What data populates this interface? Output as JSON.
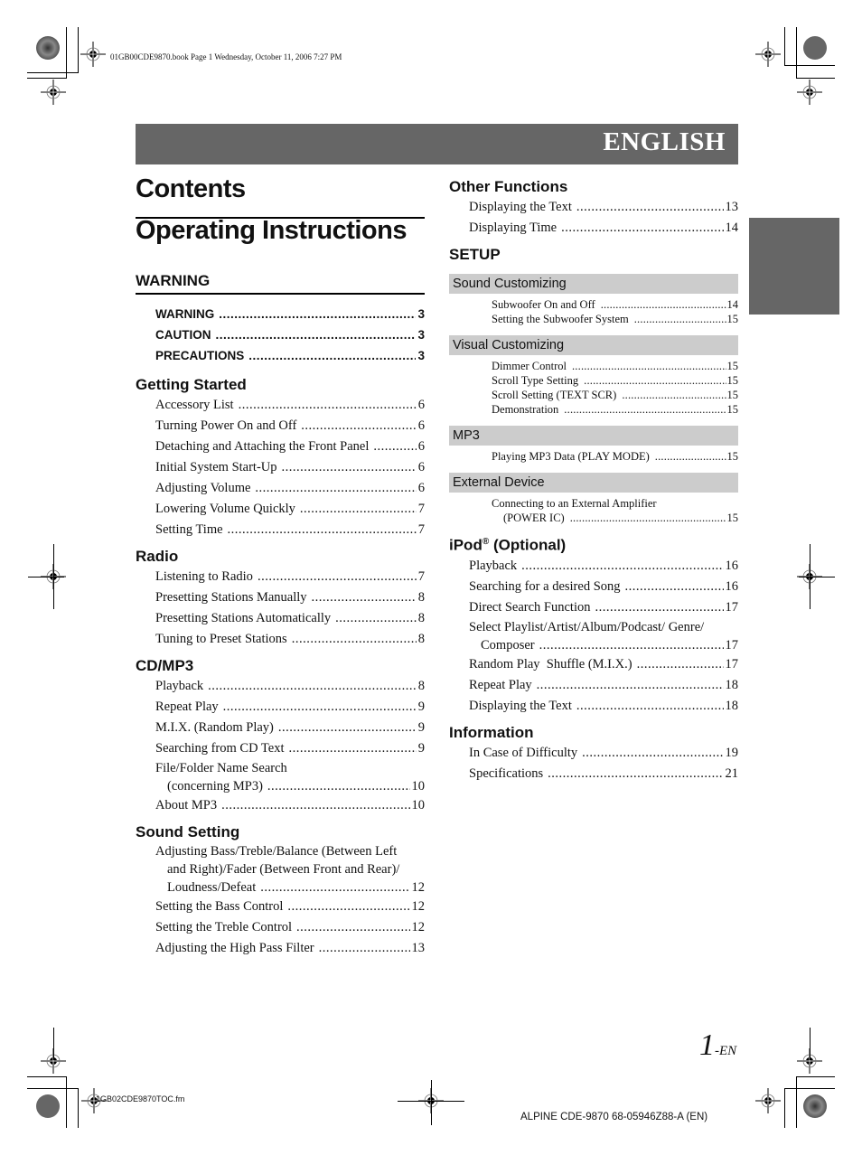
{
  "print_header": {
    "info": "01GB00CDE9870.book  Page 1  Wednesday, October 11, 2006  7:27 PM"
  },
  "banner": {
    "language": "ENGLISH",
    "color": "#666666"
  },
  "titles": {
    "contents": "Contents",
    "operating": "Operating Instructions"
  },
  "left_sections": [
    {
      "heading": "WARNING",
      "entries": [
        {
          "title": "WARNING",
          "page": "3"
        },
        {
          "title": "CAUTION",
          "page": "3"
        },
        {
          "title": "PRECAUTIONS",
          "page": "3"
        }
      ]
    },
    {
      "heading": "Getting Started",
      "entries": [
        {
          "title": "Accessory List",
          "page": "6"
        },
        {
          "title": "Turning Power On and Off",
          "page": "6"
        },
        {
          "title": "Detaching and Attaching the Front Panel",
          "page": "6"
        },
        {
          "title": "Initial System Start-Up",
          "page": "6"
        },
        {
          "title": "Adjusting Volume",
          "page": "6"
        },
        {
          "title": "Lowering Volume Quickly",
          "page": "7"
        },
        {
          "title": "Setting Time",
          "page": "7"
        }
      ]
    },
    {
      "heading": "Radio",
      "entries": [
        {
          "title": "Listening to Radio",
          "page": "7"
        },
        {
          "title": "Presetting Stations Manually",
          "page": "8"
        },
        {
          "title": "Presetting Stations Automatically",
          "page": "8"
        },
        {
          "title": "Tuning to Preset Stations",
          "page": "8"
        }
      ]
    },
    {
      "heading": "CD/MP3",
      "entries": [
        {
          "title": "Playback",
          "page": "8"
        },
        {
          "title": "Repeat Play",
          "page": "9"
        },
        {
          "title": "M.I.X. (Random Play)",
          "page": "9"
        },
        {
          "title": "Searching from CD Text",
          "page": "9"
        },
        {
          "title_line1": "File/Folder Name Search",
          "title_line2": "(concerning MP3)",
          "page": "10"
        },
        {
          "title": "About MP3",
          "page": "10"
        }
      ]
    },
    {
      "heading": "Sound Setting",
      "entries": [
        {
          "title_line1": "Adjusting Bass/Treble/Balance (Between Left",
          "title_line2": "and Right)/Fader (Between Front and Rear)/",
          "title_line3": "Loudness/Defeat",
          "page": "12"
        },
        {
          "title": "Setting the Bass Control",
          "page": "12"
        },
        {
          "title": "Setting the Treble Control",
          "page": "12"
        },
        {
          "title": "Adjusting the High Pass Filter",
          "page": "13"
        }
      ]
    }
  ],
  "right_sections": {
    "other_functions": {
      "heading": "Other Functions",
      "entries": [
        {
          "title": "Displaying the Text",
          "page": "13"
        },
        {
          "title": "Displaying Time",
          "page": "14"
        }
      ]
    },
    "setup": {
      "heading": "SETUP",
      "subsections": [
        {
          "heading": "Sound Customizing",
          "entries": [
            {
              "title": "Subwoofer On and Off",
              "page": "14"
            },
            {
              "title": "Setting the Subwoofer System",
              "page": "15"
            }
          ]
        },
        {
          "heading": "Visual Customizing",
          "entries": [
            {
              "title": "Dimmer Control",
              "page": "15"
            },
            {
              "title": "Scroll Type Setting",
              "page": "15"
            },
            {
              "title": "Scroll Setting (TEXT SCR)",
              "page": "15"
            },
            {
              "title": "Demonstration",
              "page": "15"
            }
          ]
        },
        {
          "heading": "MP3",
          "entries": [
            {
              "title": "Playing MP3 Data (PLAY MODE)",
              "page": "15"
            }
          ]
        },
        {
          "heading": "External Device",
          "entries": [
            {
              "title_line1": "Connecting to an External Amplifier",
              "title_line2": "(POWER IC)",
              "page": "15"
            }
          ]
        }
      ]
    },
    "ipod": {
      "heading_main": "iPod",
      "heading_sup": "®",
      "heading_rest": " (Optional)",
      "entries": [
        {
          "title": "Playback",
          "page": "16"
        },
        {
          "title": "Searching for a desired Song",
          "page": "16"
        },
        {
          "title": "Direct Search Function",
          "page": "17"
        },
        {
          "title_line1": "Select Playlist/Artist/Album/Podcast/ Genre/",
          "title_line2": "Composer",
          "page": "17"
        },
        {
          "title": "Random Play  Shuffle (M.I.X.)",
          "page": "17"
        },
        {
          "title": "Repeat Play",
          "page": "18"
        },
        {
          "title": "Displaying the Text",
          "page": "18"
        }
      ]
    },
    "information": {
      "heading": "Information",
      "entries": [
        {
          "title": "In Case of Difficulty",
          "page": "19"
        },
        {
          "title": "Specifications",
          "page": "21"
        }
      ]
    }
  },
  "footer": {
    "page_number": "1",
    "page_suffix": "-EN",
    "file_name": "1GB02CDE9870TOC.fm",
    "model": "ALPINE CDE-9870 68-05946Z88-A (EN)"
  },
  "colors": {
    "banner": "#666666",
    "subsection_band": "#cccccc",
    "text": "#111111"
  }
}
